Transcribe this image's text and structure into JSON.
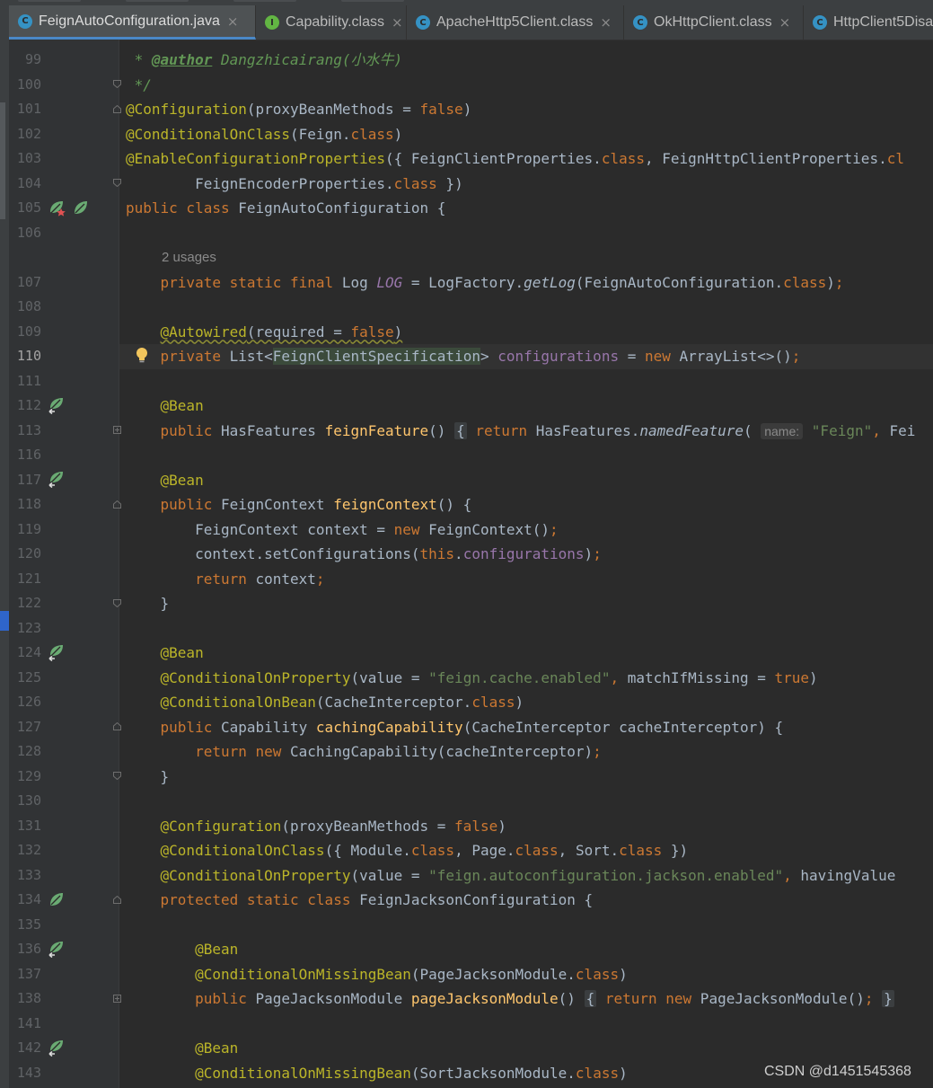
{
  "tabs": [
    {
      "label": "FeignAutoConfiguration.java",
      "icon": "class-icon",
      "active": true
    },
    {
      "label": "Capability.class",
      "icon": "interface-icon",
      "active": false
    },
    {
      "label": "ApacheHttp5Client.class",
      "icon": "class-icon",
      "active": false
    },
    {
      "label": "OkHttpClient.class",
      "icon": "class-icon",
      "active": false
    },
    {
      "label": "HttpClient5Disa",
      "icon": "class-icon",
      "active": false
    }
  ],
  "tab_close_glyph": "×",
  "usages_hint": "2 usages",
  "inlay_name": "name:",
  "lines": [
    {
      "n": "99"
    },
    {
      "n": "100"
    },
    {
      "n": "101"
    },
    {
      "n": "102"
    },
    {
      "n": "103"
    },
    {
      "n": "104"
    },
    {
      "n": "105"
    },
    {
      "n": "106"
    },
    {
      "n": "107"
    },
    {
      "n": "108"
    },
    {
      "n": "109"
    },
    {
      "n": "110"
    },
    {
      "n": "111"
    },
    {
      "n": "112"
    },
    {
      "n": "113"
    },
    {
      "n": "116"
    },
    {
      "n": "117"
    },
    {
      "n": "118"
    },
    {
      "n": "119"
    },
    {
      "n": "120"
    },
    {
      "n": "121"
    },
    {
      "n": "122"
    },
    {
      "n": "123"
    },
    {
      "n": "124"
    },
    {
      "n": "125"
    },
    {
      "n": "126"
    },
    {
      "n": "127"
    },
    {
      "n": "128"
    },
    {
      "n": "129"
    },
    {
      "n": "130"
    },
    {
      "n": "131"
    },
    {
      "n": "132"
    },
    {
      "n": "133"
    },
    {
      "n": "134"
    },
    {
      "n": "135"
    },
    {
      "n": "136"
    },
    {
      "n": "137"
    },
    {
      "n": "138"
    },
    {
      "n": "141"
    },
    {
      "n": "142"
    },
    {
      "n": "143"
    }
  ],
  "watermark": "CSDN @d1451545368"
}
